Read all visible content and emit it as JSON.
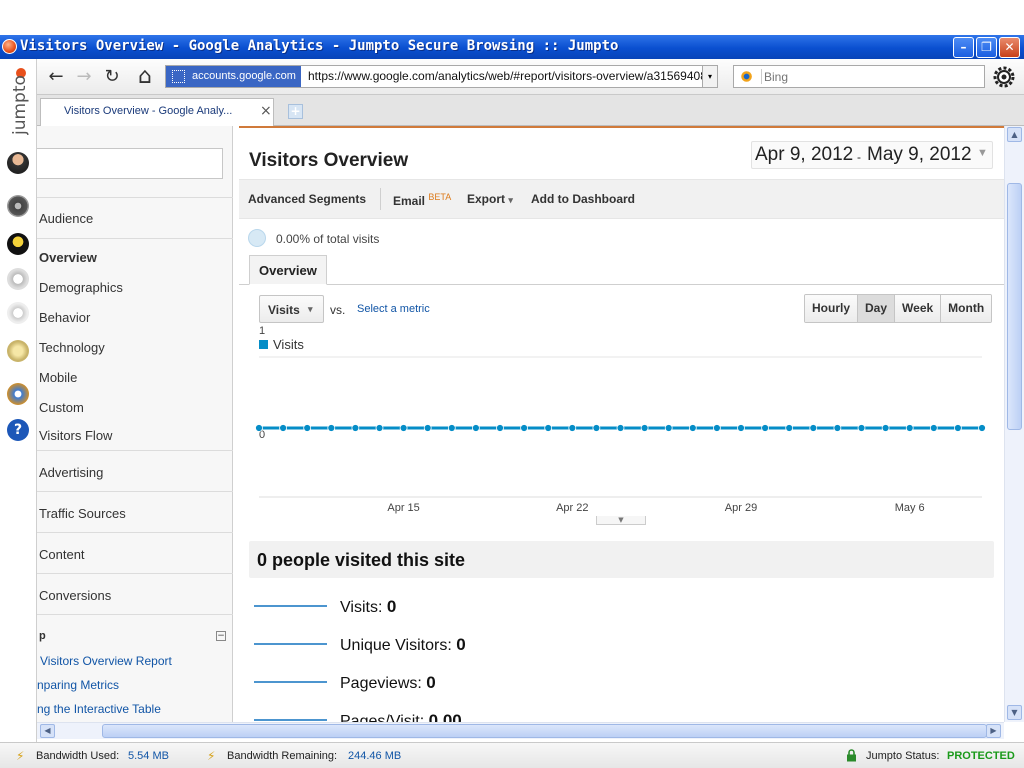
{
  "window": {
    "title": "Visitors Overview - Google Analytics - Jumpto Secure Browsing :: Jumpto",
    "minimize_label": "–",
    "maximize_label": "❐",
    "close_label": "✕"
  },
  "branding": {
    "logo_text": "jumpto"
  },
  "nav": {
    "back_label": "←",
    "forward_label": "→",
    "reload_label": "↻",
    "home_label": "⌂",
    "site_badge": "accounts.google.com",
    "url": "https://www.google.com/analytics/web/#report/visitors-overview/a31569408w5",
    "dropdown_label": "▾",
    "search_placeholder": "Bing"
  },
  "tabs": [
    {
      "label": "Visitors Overview - Google Analy...",
      "close_label": "×"
    }
  ],
  "sidebar": {
    "items": [
      {
        "label": "Audience"
      },
      {
        "label": "Overview"
      },
      {
        "label": "Demographics"
      },
      {
        "label": "Behavior"
      },
      {
        "label": "Technology"
      },
      {
        "label": "Mobile"
      },
      {
        "label": "Custom"
      },
      {
        "label": "Visitors Flow"
      },
      {
        "label": "Advertising"
      },
      {
        "label": "Traffic Sources"
      },
      {
        "label": "Content"
      },
      {
        "label": "Conversions"
      }
    ],
    "help_heading": "p",
    "collapse_label": "−",
    "help_links": [
      {
        "label": "Visitors Overview Report"
      },
      {
        "label": "nparing Metrics"
      },
      {
        "label": "ng the Interactive Table"
      }
    ]
  },
  "report": {
    "title": "Visitors Overview",
    "date_start": "Apr 9, 2012",
    "date_separator": "-",
    "date_end": "May 9, 2012",
    "date_caret": "▼",
    "actions": {
      "advanced_segments": "Advanced Segments",
      "email": "Email",
      "email_badge": "BETA",
      "export": "Export",
      "export_caret": "▾",
      "add_dashboard": "Add to Dashboard"
    },
    "percent_text": "0.00% of total visits",
    "tab_overview": "Overview",
    "metric_select": "Visits",
    "metric_caret": "▾",
    "vs_label": "vs.",
    "select_metric": "Select a metric",
    "granularity": [
      {
        "label": "Hourly",
        "active": false
      },
      {
        "label": "Day",
        "active": true
      },
      {
        "label": "Week",
        "active": false
      },
      {
        "label": "Month",
        "active": false
      }
    ],
    "expand_label": "▼",
    "summary_title": "0 people visited this site",
    "stats": [
      {
        "label": "Visits:",
        "value": "0"
      },
      {
        "label": "Unique Visitors:",
        "value": "0"
      },
      {
        "label": "Pageviews:",
        "value": "0"
      },
      {
        "label": "Pages/Visit:",
        "value": "0.00"
      }
    ]
  },
  "chart_data": {
    "type": "line",
    "legend": [
      "Visits"
    ],
    "x": [
      "Apr 9",
      "Apr 10",
      "Apr 11",
      "Apr 12",
      "Apr 13",
      "Apr 14",
      "Apr 15",
      "Apr 16",
      "Apr 17",
      "Apr 18",
      "Apr 19",
      "Apr 20",
      "Apr 21",
      "Apr 22",
      "Apr 23",
      "Apr 24",
      "Apr 25",
      "Apr 26",
      "Apr 27",
      "Apr 28",
      "Apr 29",
      "Apr 30",
      "May 1",
      "May 2",
      "May 3",
      "May 4",
      "May 5",
      "May 6",
      "May 7",
      "May 8",
      "May 9"
    ],
    "series": [
      {
        "name": "Visits",
        "values": [
          0,
          0,
          0,
          0,
          0,
          0,
          0,
          0,
          0,
          0,
          0,
          0,
          0,
          0,
          0,
          0,
          0,
          0,
          0,
          0,
          0,
          0,
          0,
          0,
          0,
          0,
          0,
          0,
          0,
          0,
          0
        ]
      }
    ],
    "x_ticks": [
      "Apr 15",
      "Apr 22",
      "Apr 29",
      "May 6"
    ],
    "y_ticks": [
      "1",
      "0"
    ],
    "ylim": [
      0,
      1
    ],
    "color": "#058dc7",
    "grid": true,
    "legend_placement": "top-left"
  },
  "scroll": {
    "up": "▲",
    "down": "▼",
    "left": "◀",
    "right": "▶"
  },
  "status": {
    "bandwidth_used_label": "Bandwidth Used:",
    "bandwidth_used": "5.54 MB",
    "bandwidth_remaining_label": "Bandwidth Remaining:",
    "bandwidth_remaining": "244.46 MB",
    "jumpto_status_label": "Jumpto Status:",
    "jumpto_status": "PROTECTED"
  },
  "colors": {
    "accent": "#058dc7",
    "titlebar": "#0a4fd0",
    "protected": "#1a9a1a"
  }
}
